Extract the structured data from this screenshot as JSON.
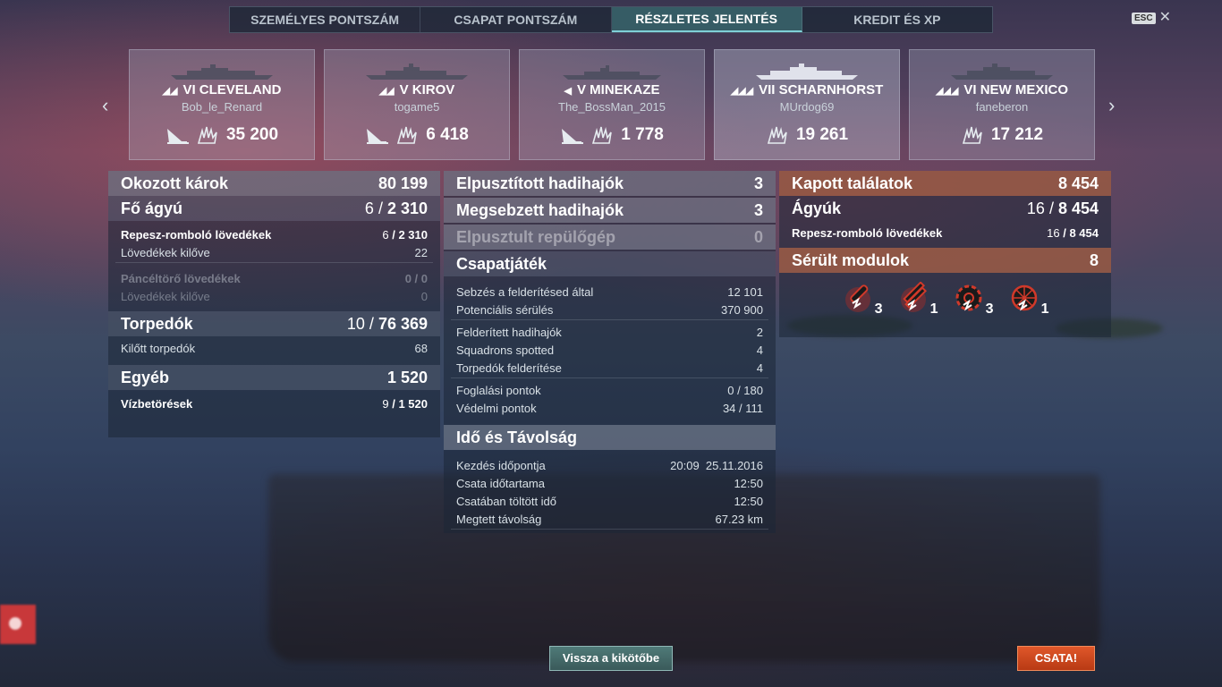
{
  "tabs": [
    {
      "label": "SZEMÉLYES PONTSZÁM"
    },
    {
      "label": "CSAPAT PONTSZÁM"
    },
    {
      "label": "RÉSZLETES JELENTÉS"
    },
    {
      "label": "KREDIT ÉS XP"
    }
  ],
  "active_tab": "RÉSZLETES JELENTÉS",
  "esc": {
    "key": "ESC",
    "close": "✕"
  },
  "nav": {
    "prev": "‹",
    "next": "›"
  },
  "cards": [
    {
      "tier": "VI",
      "ship": "CLEVELAND",
      "player": "Bob_le_Renard",
      "value": "35 200"
    },
    {
      "tier": "V",
      "ship": "KIROV",
      "player": "togame5",
      "value": "6 418"
    },
    {
      "tier": "V",
      "ship": "MINEKAZE",
      "player": "The_BossMan_2015",
      "value": "1 778"
    },
    {
      "tier": "VII",
      "ship": "SCHARNHORST",
      "player": "MUrdog69",
      "value": "19 261"
    },
    {
      "tier": "VI",
      "ship": "NEW MEXICO",
      "player": "faneberon",
      "value": "17 212"
    }
  ],
  "damage": {
    "title": "Okozott károk",
    "total": "80 199",
    "main_guns": {
      "label": "Fő ágyú",
      "hits": "6",
      "dmg": "2 310"
    },
    "he": {
      "label": "Repesz-romboló lövedékek",
      "hits": "6",
      "dmg": "2 310"
    },
    "he_fired": {
      "label": "Lövedékek kilőve",
      "value": "22"
    },
    "ap": {
      "label": "Páncéltörő lövedékek",
      "value": "0 / 0"
    },
    "ap_fired": {
      "label": "Lövedékek kilőve",
      "value": "0"
    },
    "torpedoes": {
      "label": "Torpedók",
      "hits": "10",
      "dmg": "76 369"
    },
    "torp_fired": {
      "label": "Kilőtt torpedók",
      "value": "68"
    },
    "other": {
      "label": "Egyéb",
      "value": "1 520"
    },
    "flooding": {
      "label": "Vízbetörések",
      "hits": "9",
      "dmg": "1 520"
    }
  },
  "middle": {
    "destroyed": {
      "label": "Elpusztított hadihajók",
      "value": "3"
    },
    "damaged": {
      "label": "Megsebzett hadihajók",
      "value": "3"
    },
    "planes": {
      "label": "Elpusztult repülőgép",
      "value": "0"
    },
    "teamplay": {
      "title": "Csapatjáték",
      "rows1": [
        {
          "label": "Sebzés a felderítésed által",
          "value": "12 101"
        },
        {
          "label": "Potenciális sérülés",
          "value": "370 900"
        }
      ],
      "rows2": [
        {
          "label": "Felderített hadihajók",
          "value": "2"
        },
        {
          "label": "Squadrons spotted",
          "value": "4"
        },
        {
          "label": "Torpedók felderítése",
          "value": "4"
        }
      ],
      "rows3": [
        {
          "label": "Foglalási pontok",
          "value": "0 / 180"
        },
        {
          "label": "Védelmi pontok",
          "value": "34 / 111"
        }
      ]
    },
    "time": {
      "title": "Idő és Távolság",
      "rows": [
        {
          "label": "Kezdés időpontja",
          "value": "20:09  25.11.2016"
        },
        {
          "label": "Csata időtartama",
          "value": "12:50"
        },
        {
          "label": "Csatában töltött idő",
          "value": "12:50"
        },
        {
          "label": "Megtett távolság",
          "value": "67.23 km"
        }
      ]
    }
  },
  "received": {
    "title": "Kapott találatok",
    "total": "8 454",
    "guns": {
      "label": "Ágyúk",
      "hits": "16",
      "dmg": "8 454"
    },
    "he": {
      "label": "Repesz-romboló lövedékek",
      "hits": "16",
      "dmg": "8 454"
    }
  },
  "modules": {
    "title": "Sérült modulok",
    "total": "8",
    "items": [
      {
        "icon": "torpedo-tubes-damaged-icon",
        "count": "3"
      },
      {
        "icon": "main-battery-damaged-icon",
        "count": "1"
      },
      {
        "icon": "engine-damaged-icon",
        "count": "3"
      },
      {
        "icon": "steering-damaged-icon",
        "count": "1"
      }
    ]
  },
  "buttons": {
    "back": "Vissza a kikötőbe",
    "battle": "CSATA!"
  },
  "colors": {
    "accent_tab": "#7fd0d8",
    "battle": "#d0481f",
    "received_header": "#c86e46"
  }
}
